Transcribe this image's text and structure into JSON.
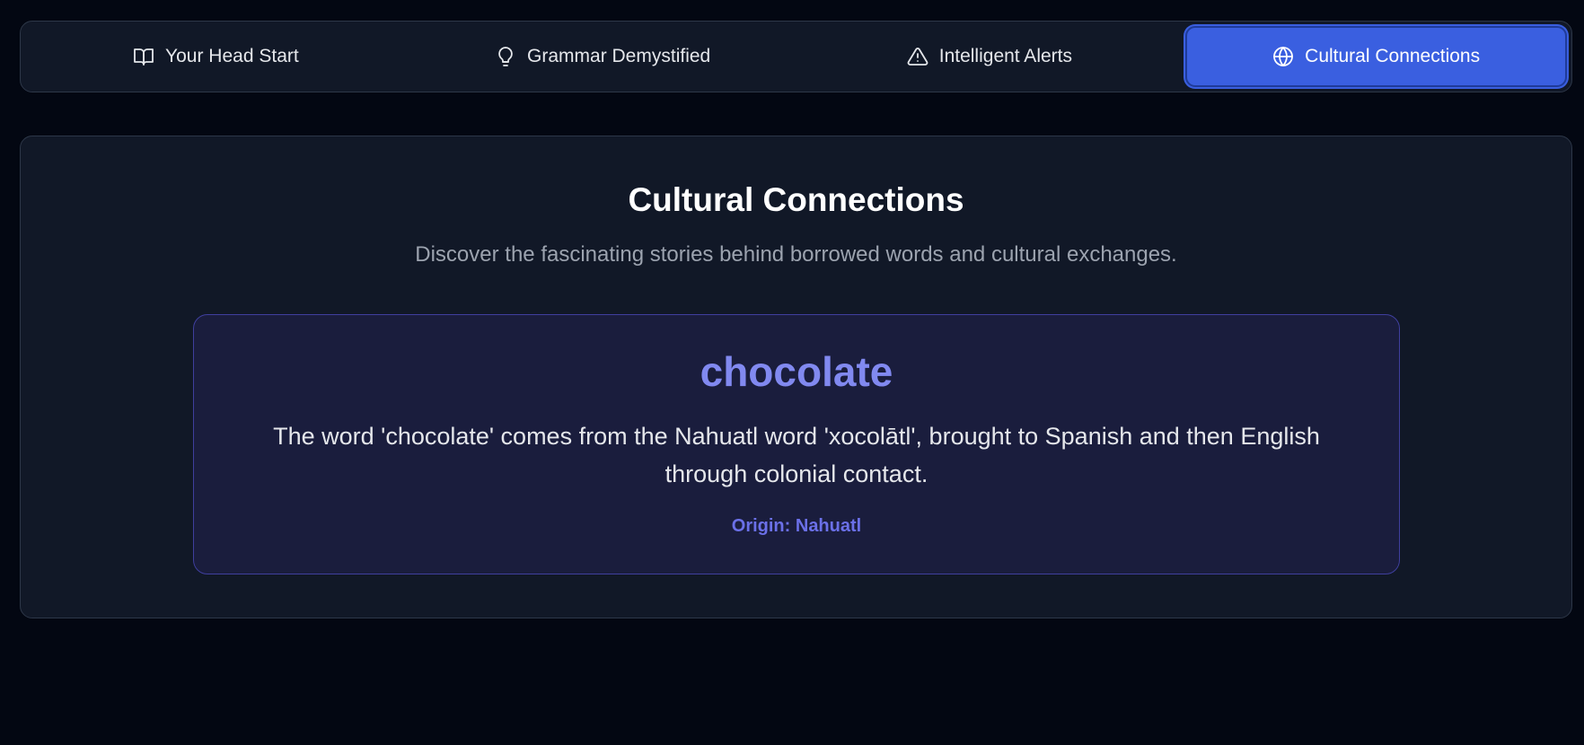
{
  "tabs": [
    {
      "label": "Your Head Start",
      "icon": "book-open-icon",
      "active": false
    },
    {
      "label": "Grammar Demystified",
      "icon": "lightbulb-icon",
      "active": false
    },
    {
      "label": "Intelligent Alerts",
      "icon": "alert-triangle-icon",
      "active": false
    },
    {
      "label": "Cultural Connections",
      "icon": "globe-icon",
      "active": true
    }
  ],
  "panel": {
    "title": "Cultural Connections",
    "subtitle": "Discover the fascinating stories behind borrowed words and cultural exchanges."
  },
  "word_card": {
    "term": "chocolate",
    "description": "The word 'chocolate' comes from the Nahuatl word 'xocolātl', brought to Spanish and then English through colonial contact.",
    "origin": "Origin: Nahuatl"
  },
  "colors": {
    "background": "#030712",
    "surface": "#111827",
    "accent": "#3a5fe0",
    "term": "#8189f0",
    "origin": "#6b70e8"
  }
}
